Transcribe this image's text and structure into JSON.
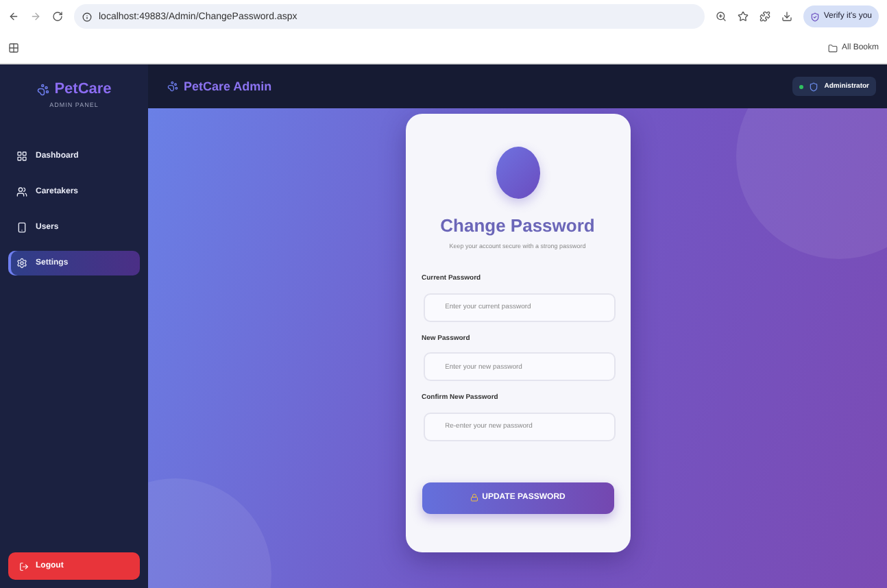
{
  "browser": {
    "url": "localhost:49883/Admin/ChangePassword.aspx",
    "profile_button": "Verify it's you",
    "bookmarks_label": "All Bookm"
  },
  "sidebar": {
    "brand": "PetCare",
    "subtitle": "ADMIN PANEL",
    "items": [
      {
        "label": "Dashboard",
        "selected": false
      },
      {
        "label": "Caretakers",
        "selected": false
      },
      {
        "label": "Users",
        "selected": false
      },
      {
        "label": "Settings",
        "selected": true
      }
    ],
    "logout": "Logout"
  },
  "header": {
    "title": "PetCare Admin",
    "user": "Administrator"
  },
  "form": {
    "title": "Change Password",
    "subtitle": "Keep your account secure with a strong password",
    "fields": [
      {
        "label": "Current Password",
        "placeholder": "Enter your current password"
      },
      {
        "label": "New Password",
        "placeholder": "Enter your new password"
      },
      {
        "label": "Confirm New Password",
        "placeholder": "Re-enter your new password"
      }
    ],
    "button": "UPDATE PASSWORD"
  }
}
